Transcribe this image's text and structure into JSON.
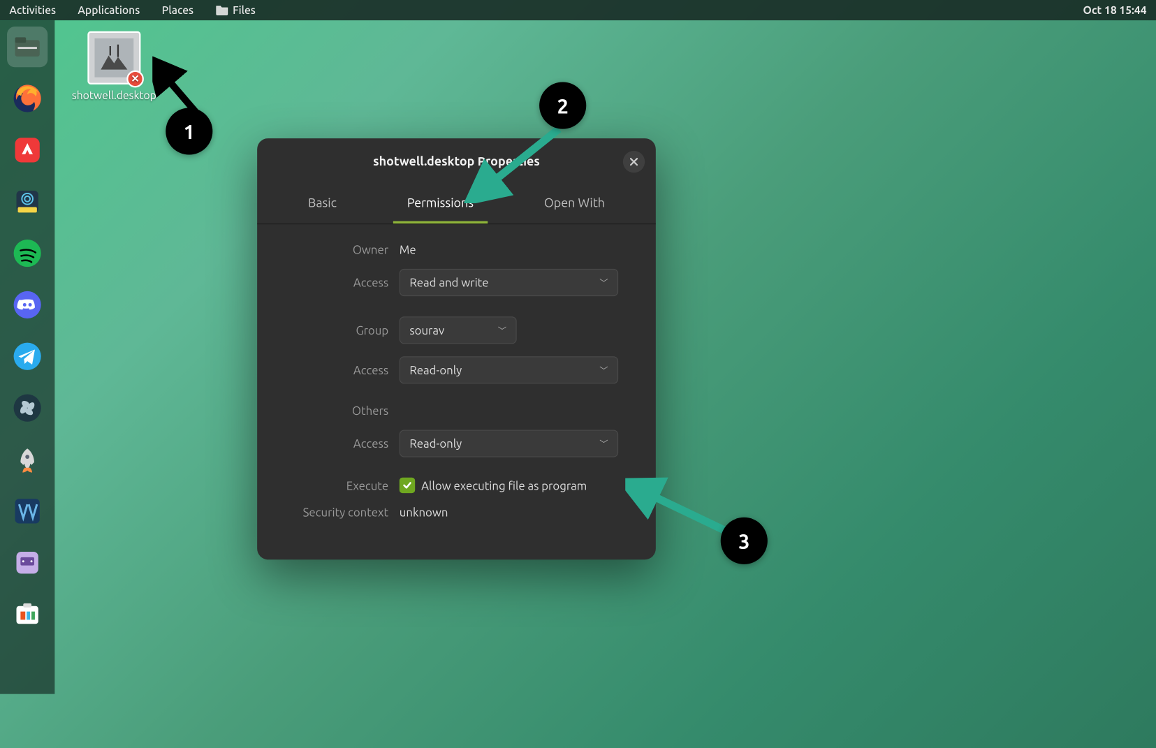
{
  "topbar": {
    "activities": "Activities",
    "applications": "Applications",
    "places": "Places",
    "files": "Files",
    "clock": "Oct 18  15:44"
  },
  "desktop": {
    "icon_label": "shotwell.desktop"
  },
  "dialog": {
    "title": "shotwell.desktop Properties",
    "tabs": {
      "basic": "Basic",
      "permissions": "Permissions",
      "open_with": "Open With"
    },
    "owner_label": "Owner",
    "owner_value": "Me",
    "access_label": "Access",
    "owner_access": "Read and write",
    "group_label": "Group",
    "group_value": "sourav",
    "group_access": "Read-only",
    "others_label": "Others",
    "others_access": "Read-only",
    "execute_label": "Execute",
    "execute_checkbox": "Allow executing file as program",
    "security_label": "Security context",
    "security_value": "unknown"
  },
  "annotations": {
    "step1": "1",
    "step2": "2",
    "step3": "3"
  },
  "dock_apps": [
    {
      "name": "files",
      "color": "#6b7d6e"
    },
    {
      "name": "firefox",
      "color": "#ff7139"
    },
    {
      "name": "vivaldi",
      "color": "#ef3939"
    },
    {
      "name": "remmina",
      "color": "#f5d547"
    },
    {
      "name": "spotify",
      "color": "#1db954"
    },
    {
      "name": "discord",
      "color": "#5865f2"
    },
    {
      "name": "telegram",
      "color": "#2aabee"
    },
    {
      "name": "fan",
      "color": "#4a6b7a"
    },
    {
      "name": "rocket",
      "color": "#5a6472"
    },
    {
      "name": "virtualbox",
      "color": "#183a61"
    },
    {
      "name": "app11",
      "color": "#9b7fc9"
    },
    {
      "name": "software",
      "color": "#ffffff"
    }
  ]
}
